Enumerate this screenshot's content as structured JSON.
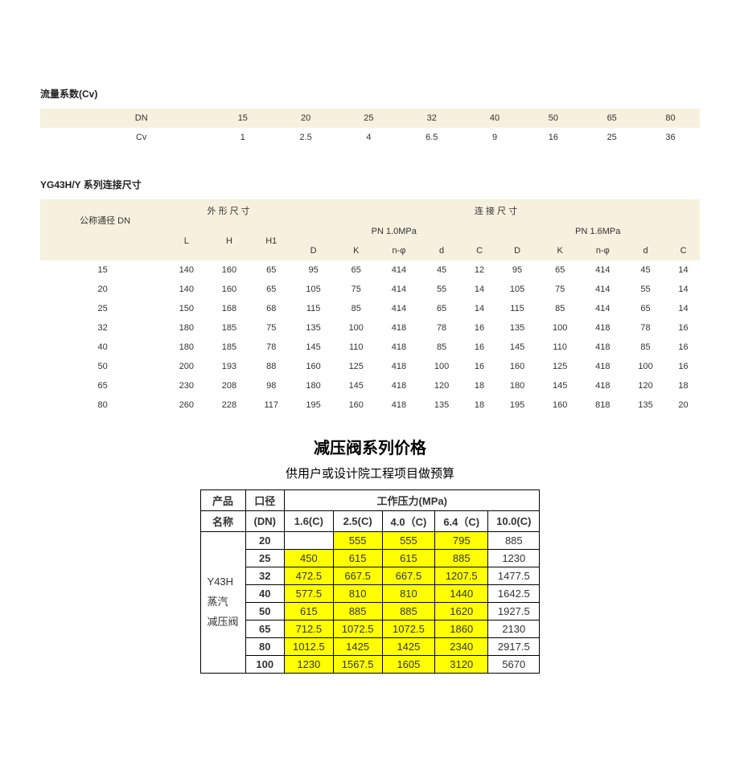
{
  "cv": {
    "title": "流量系数(Cv)",
    "rowDN": [
      "DN",
      "15",
      "20",
      "25",
      "32",
      "40",
      "50",
      "65",
      "80"
    ],
    "rowCv": [
      "Cv",
      "1",
      "2.5",
      "4",
      "6.5",
      "9",
      "16",
      "25",
      "36"
    ]
  },
  "dim": {
    "title": "YG43H/Y 系列连接尺寸",
    "h1": "外 形 尺 寸",
    "h2": "连 接 尺 寸",
    "dnLabel": "公称通径  DN",
    "pn1": "PN 1.0MPa",
    "pn2": "PN 1.6MPa",
    "cols": [
      "L",
      "H",
      "H1",
      "D",
      "K",
      "n-φ",
      "d",
      "C",
      "D",
      "K",
      "n-φ",
      "d",
      "C"
    ],
    "rows": [
      [
        "15",
        "140",
        "160",
        "65",
        "95",
        "65",
        "414",
        "45",
        "12",
        "95",
        "65",
        "414",
        "45",
        "14"
      ],
      [
        "20",
        "140",
        "160",
        "65",
        "105",
        "75",
        "414",
        "55",
        "14",
        "105",
        "75",
        "414",
        "55",
        "14"
      ],
      [
        "25",
        "150",
        "168",
        "68",
        "115",
        "85",
        "414",
        "65",
        "14",
        "115",
        "85",
        "414",
        "65",
        "14"
      ],
      [
        "32",
        "180",
        "185",
        "75",
        "135",
        "100",
        "418",
        "78",
        "16",
        "135",
        "100",
        "418",
        "78",
        "16"
      ],
      [
        "40",
        "180",
        "185",
        "78",
        "145",
        "110",
        "418",
        "85",
        "16",
        "145",
        "110",
        "418",
        "85",
        "16"
      ],
      [
        "50",
        "200",
        "193",
        "88",
        "160",
        "125",
        "418",
        "100",
        "16",
        "160",
        "125",
        "418",
        "100",
        "16"
      ],
      [
        "65",
        "230",
        "208",
        "98",
        "180",
        "145",
        "418",
        "120",
        "18",
        "180",
        "145",
        "418",
        "120",
        "18"
      ],
      [
        "80",
        "260",
        "228",
        "117",
        "195",
        "160",
        "418",
        "135",
        "18",
        "195",
        "160",
        "818",
        "135",
        "20"
      ]
    ]
  },
  "price": {
    "title": "减压阀系列价格",
    "sub": "供用户或设计院工程项目做预算",
    "h_name1": "产品",
    "h_name2": "名称",
    "h_dn1": "口径",
    "h_dn2": "(DN)",
    "h_wp": "工作压力(MPa)",
    "h_c1": "1.6(C)",
    "h_c2": "2.5(C)",
    "h_c3": "4.0（C)",
    "h_c4": "6.4（C)",
    "h_c5": "10.0(C)",
    "name": "Y43H\n蒸汽\n减压阀",
    "rows": [
      {
        "dn": "20",
        "v": [
          "",
          "555",
          "555",
          "795",
          "885"
        ],
        "y": [
          0,
          1,
          1,
          1,
          0
        ]
      },
      {
        "dn": "25",
        "v": [
          "450",
          "615",
          "615",
          "885",
          "1230"
        ],
        "y": [
          1,
          1,
          1,
          1,
          0
        ]
      },
      {
        "dn": "32",
        "v": [
          "472.5",
          "667.5",
          "667.5",
          "1207.5",
          "1477.5"
        ],
        "y": [
          1,
          1,
          1,
          1,
          0
        ]
      },
      {
        "dn": "40",
        "v": [
          "577.5",
          "810",
          "810",
          "1440",
          "1642.5"
        ],
        "y": [
          1,
          1,
          1,
          1,
          0
        ]
      },
      {
        "dn": "50",
        "v": [
          "615",
          "885",
          "885",
          "1620",
          "1927.5"
        ],
        "y": [
          1,
          1,
          1,
          1,
          0
        ]
      },
      {
        "dn": "65",
        "v": [
          "712.5",
          "1072.5",
          "1072.5",
          "1860",
          "2130"
        ],
        "y": [
          1,
          1,
          1,
          1,
          0
        ]
      },
      {
        "dn": "80",
        "v": [
          "1012.5",
          "1425",
          "1425",
          "2340",
          "2917.5"
        ],
        "y": [
          1,
          1,
          1,
          1,
          0
        ]
      },
      {
        "dn": "100",
        "v": [
          "1230",
          "1567.5",
          "1605",
          "3120",
          "5670"
        ],
        "y": [
          1,
          1,
          1,
          1,
          0
        ]
      }
    ]
  }
}
